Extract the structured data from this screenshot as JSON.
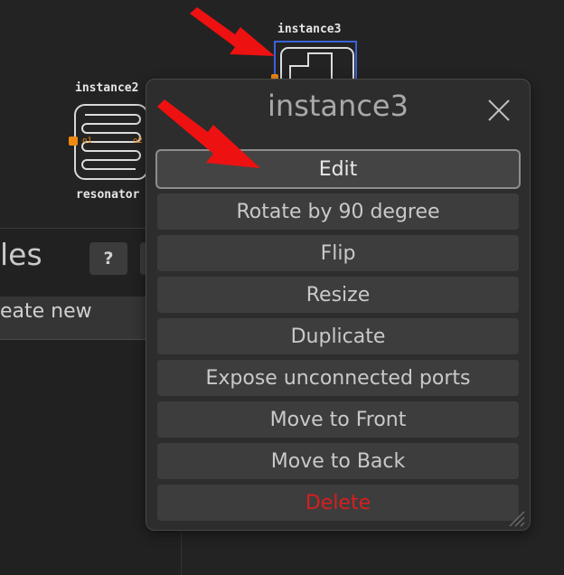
{
  "canvas": {
    "instance2": {
      "label": "instance2",
      "sublabel": "resonator",
      "port_left": "o1",
      "port_right": "o2"
    },
    "instance3": {
      "label": "instance3"
    }
  },
  "side_panel": {
    "title": "les",
    "help_label": "?",
    "create_label": "eate new"
  },
  "dialog": {
    "title": "instance3",
    "buttons": [
      "Edit",
      "Rotate by 90 degree",
      "Flip",
      "Resize",
      "Duplicate",
      "Expose unconnected ports",
      "Move to Front",
      "Move to Back",
      "Delete"
    ]
  },
  "colors": {
    "background": "#232323",
    "dialog": "#2d2d2d",
    "button": "#3d3d3d",
    "danger": "#d81e1e",
    "port": "#f08a10",
    "selection": "#3a63d8",
    "annotation_arrow": "#ee1111"
  },
  "icons": {
    "close": "close-icon",
    "resize": "resize-grip-icon",
    "arrow": "red-arrow-icon"
  }
}
